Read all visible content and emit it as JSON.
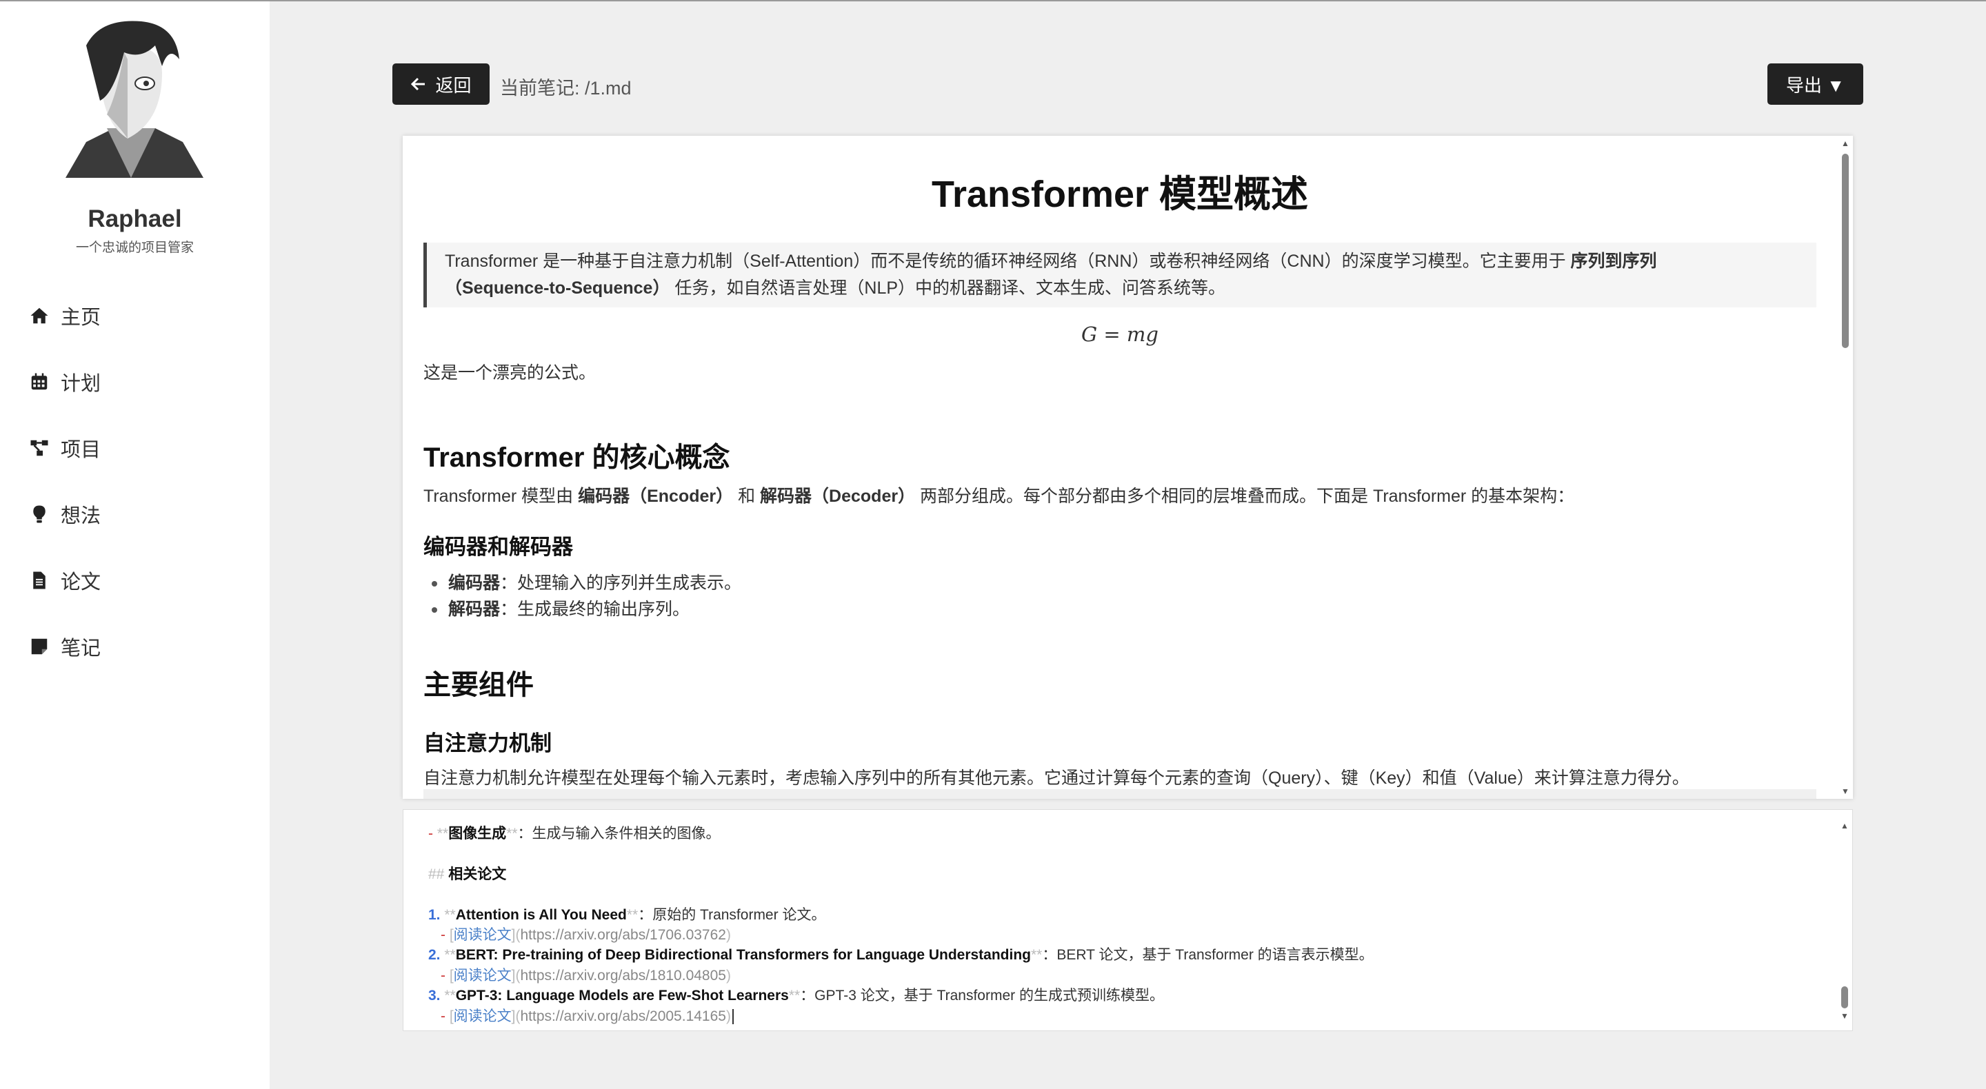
{
  "profile": {
    "name": "Raphael",
    "subtitle": "一个忠诚的项目管家"
  },
  "nav": [
    {
      "label": "主页",
      "icon": "home-icon"
    },
    {
      "label": "计划",
      "icon": "calendar-icon"
    },
    {
      "label": "项目",
      "icon": "project-tree-icon"
    },
    {
      "label": "想法",
      "icon": "lightbulb-icon"
    },
    {
      "label": "论文",
      "icon": "document-icon"
    },
    {
      "label": "笔记",
      "icon": "note-icon"
    }
  ],
  "toolbar": {
    "back_label": "返回",
    "note_path": "当前笔记: /1.md",
    "export_label": "导出 ▼"
  },
  "preview": {
    "title": "Transformer 模型概述",
    "quote_pre": "Transformer 是一种基于自注意力机制（Self-Attention）而不是传统的循环神经网络（RNN）或卷积神经网络（CNN）的深度学习模型。它主要用于 ",
    "quote_bold": "序列到序列（Sequence-to-Sequence）",
    "quote_post": " 任务，如自然语言处理（NLP）中的机器翻译、文本生成、问答系统等。",
    "formula": "G = mg",
    "formula_note": "这是一个漂亮的公式。",
    "h2_core": "Transformer 的核心概念",
    "core_pre": "Transformer 模型由 ",
    "core_b1": "编码器（Encoder）",
    "core_mid": " 和 ",
    "core_b2": "解码器（Decoder）",
    "core_post": " 两部分组成。每个部分都由多个相同的层堆叠而成。下面是 Transformer 的基本架构：",
    "h3_encdec": "编码器和解码器",
    "list": [
      {
        "term": "编码器",
        "desc": "：处理输入的序列并生成表示。"
      },
      {
        "term": "解码器",
        "desc": "：生成最终的输出序列。"
      }
    ],
    "h2_components": "主要组件",
    "h3_attention": "自注意力机制",
    "attention_text": "自注意力机制允许模型在处理每个输入元素时，考虑输入序列中的所有其他元素。它通过计算每个元素的查询（Query）、键（Key）和值（Value）来计算注意力得分。"
  },
  "editor": {
    "line1": {
      "dash": "- ",
      "md": "**",
      "bold": "图像生成",
      "md2": "**",
      "rest": "：生成与输入条件相关的图像。"
    },
    "heading": {
      "md": "## ",
      "text": "相关论文"
    },
    "papers": [
      {
        "num": "1.",
        "title": "Attention is All You Need",
        "desc": "：原始的 Transformer 论文。",
        "link": "阅读论文",
        "url": "https://arxiv.org/abs/1706.03762"
      },
      {
        "num": "2.",
        "title": "BERT: Pre-training of Deep Bidirectional Transformers for Language Understanding",
        "desc": "：BERT 论文，基于 Transformer 的语言表示模型。",
        "link": "阅读论文",
        "url": "https://arxiv.org/abs/1810.04805"
      },
      {
        "num": "3.",
        "title": "GPT-3: Language Models are Few-Shot Learners",
        "desc": "：GPT-3 论文，基于 Transformer 的生成式预训练模型。",
        "link": "阅读论文",
        "url": "https://arxiv.org/abs/2005.14165"
      }
    ]
  }
}
